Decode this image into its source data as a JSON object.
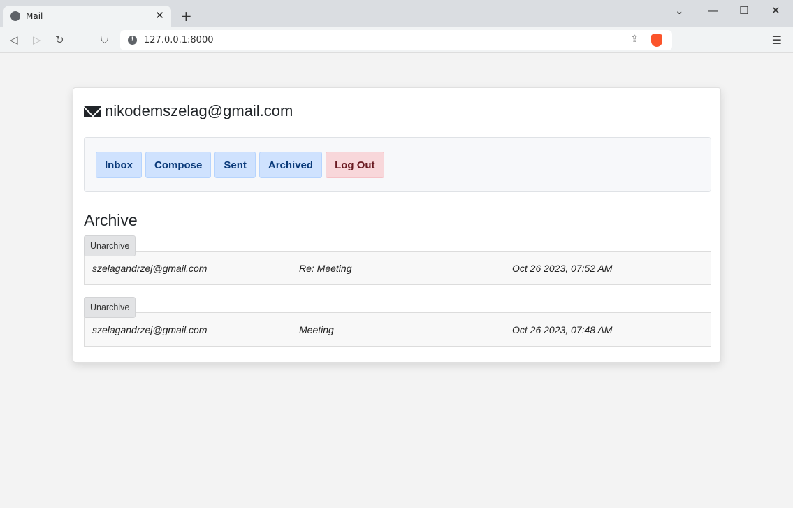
{
  "browser": {
    "tab_title": "Mail",
    "url": "127.0.0.1:8000"
  },
  "header": {
    "email": "nikodemszelag@gmail.com"
  },
  "nav": {
    "inbox": "Inbox",
    "compose": "Compose",
    "sent": "Sent",
    "archived": "Archived",
    "logout": "Log Out"
  },
  "main": {
    "heading": "Archive",
    "emails": [
      {
        "action": "Unarchive",
        "sender": "szelagandrzej@gmail.com",
        "subject": "Re: Meeting",
        "timestamp": "Oct 26 2023, 07:52 AM"
      },
      {
        "action": "Unarchive",
        "sender": "szelagandrzej@gmail.com",
        "subject": "Meeting",
        "timestamp": "Oct 26 2023, 07:48 AM"
      }
    ]
  },
  "colors": {
    "primary_bg": "#cfe2fe",
    "danger_bg": "#f8d7da"
  }
}
